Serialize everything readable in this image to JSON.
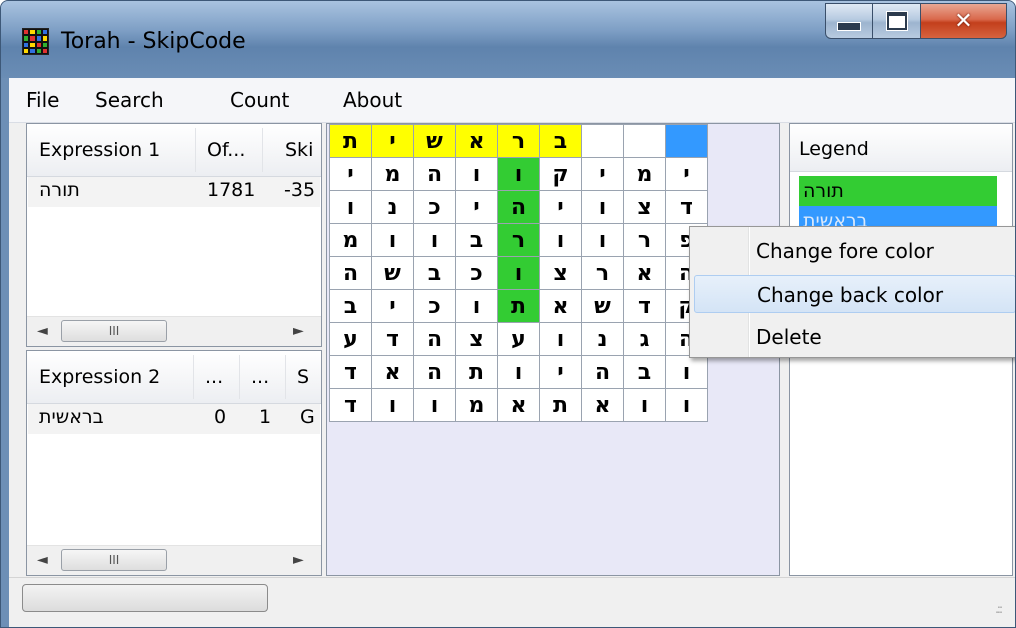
{
  "window": {
    "title": "Torah - SkipCode"
  },
  "menu": [
    "File",
    "Search",
    "Count",
    "About"
  ],
  "expression1": {
    "columns": [
      "Expression 1",
      "Of...",
      "Ski"
    ],
    "rows": [
      {
        "expr": "תורה",
        "offset": "1781",
        "skip": "-35"
      }
    ]
  },
  "expression2": {
    "columns": [
      "Expression 2",
      "...",
      "...",
      "S"
    ],
    "rows": [
      {
        "expr": "בראשית",
        "a": "0",
        "b": "1",
        "c": "G"
      }
    ]
  },
  "scrollbar": {
    "thumb_glyph": "III",
    "left_arrow": "◄",
    "right_arrow": "►"
  },
  "grid": {
    "rows": [
      [
        "ת",
        "י",
        "ש",
        "א",
        "ר",
        "ב",
        "",
        "",
        ""
      ],
      [
        "י",
        "מ",
        "ה",
        "ו",
        "ו",
        "ק",
        "י",
        "מ",
        "י"
      ],
      [
        "ו",
        "נ",
        "כ",
        "י",
        "ה",
        "י",
        "ו",
        "צ",
        "ד"
      ],
      [
        "מ",
        "ו",
        "ו",
        "ב",
        "ר",
        "ו",
        "ו",
        "ר",
        "פ"
      ],
      [
        "ה",
        "ש",
        "ב",
        "כ",
        "ו",
        "צ",
        "ר",
        "א",
        "ה"
      ],
      [
        "ב",
        "י",
        "כ",
        "ו",
        "ת",
        "א",
        "ש",
        "ד",
        "ק"
      ],
      [
        "ע",
        "ד",
        "ה",
        "צ",
        "ע",
        "ו",
        "נ",
        "ג",
        "ה"
      ],
      [
        "ד",
        "א",
        "ה",
        "ת",
        "ו",
        "י",
        "ה",
        "ב",
        "ו"
      ],
      [
        "ד",
        "ו",
        "ו",
        "מ",
        "א",
        "ת",
        "א",
        "ו",
        "ו"
      ]
    ],
    "colors": {
      "yellow": "#ffff00",
      "green": "#33cc33",
      "blue": "#3399ff",
      "white": "#ffffff"
    }
  },
  "legend": {
    "header": "Legend",
    "items": [
      {
        "label": "תורה",
        "color": "#33cc33"
      },
      {
        "label": "בראשית",
        "color": "#3399ff"
      }
    ]
  },
  "context_menu": {
    "items": [
      "Change fore color",
      "Change back color",
      "Delete"
    ],
    "highlighted": 1
  },
  "statusbar": {
    "grip": ".::"
  }
}
